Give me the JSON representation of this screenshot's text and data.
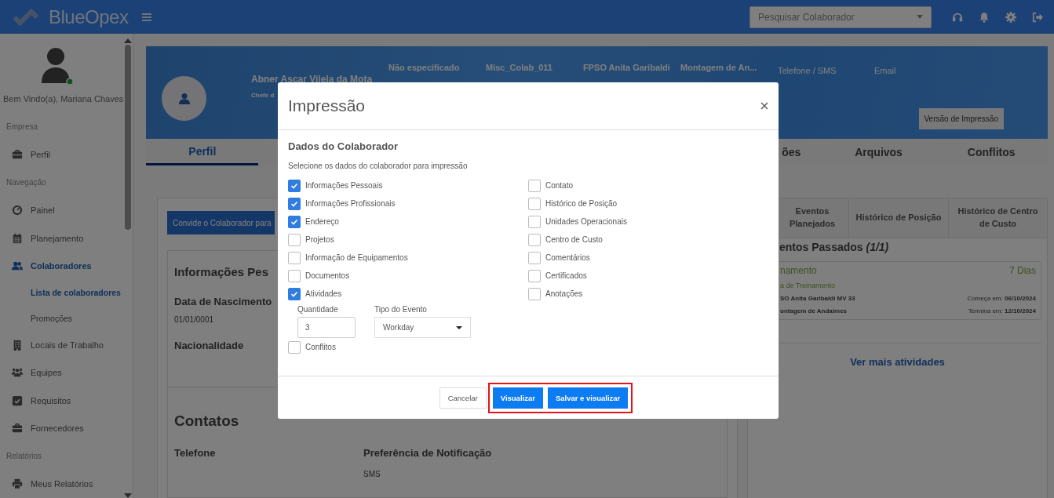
{
  "topbar": {
    "logo": "BlueOpex",
    "search": {
      "placeholder": "Pesquisar Colaborador"
    }
  },
  "sidebar": {
    "greeting": "Bem Vindo(a), Mariana Chaves",
    "sections": [
      {
        "title": "Empresa",
        "items": [
          {
            "label": "Perfil",
            "selected": false
          }
        ]
      },
      {
        "title": "Navegação",
        "items": [
          {
            "label": "Painel",
            "selected": false
          },
          {
            "label": "Planejamento",
            "selected": false
          },
          {
            "label": "Colaboradores",
            "selected": true,
            "children": [
              {
                "label": "Lista de colaboradores",
                "selected": true
              },
              {
                "label": "Promoções",
                "selected": false
              }
            ]
          },
          {
            "label": "Locais de Trabalho",
            "selected": false
          },
          {
            "label": "Equipes",
            "selected": false
          },
          {
            "label": "Requisitos",
            "selected": false
          },
          {
            "label": "Fornecedores",
            "selected": false
          }
        ]
      },
      {
        "title": "Relatórios",
        "items": [
          {
            "label": "Meus Relatórios",
            "selected": false
          }
        ]
      }
    ]
  },
  "profile": {
    "name": "Abner Ascar Vilela da Mota",
    "role": "Chefe d",
    "fields": [
      "Não especificado",
      "Misc_Colab_011",
      "FPSO Anita Garibaldi",
      "Montagem de An..."
    ],
    "contacts": [
      "Telefone / SMS",
      "Email"
    ],
    "print_button": "Versão de Impressão",
    "tabs": [
      {
        "label": "Perfil",
        "selected": true
      },
      {
        "label": "ões",
        "selected": false
      },
      {
        "label": "Arquivos",
        "selected": false
      },
      {
        "label": "Conflitos",
        "selected": false
      }
    ]
  },
  "left_panel": {
    "invite_button": "Convide o Colaborador para",
    "section_title": "Informações Pes",
    "fields": [
      {
        "label": "Data de Nascimento",
        "value": "01/01/0001"
      },
      {
        "label": "Nacionalidade"
      }
    ],
    "contacts_title": "Contatos",
    "contact_fields": [
      {
        "label": "Telefone"
      },
      {
        "label": "Preferência de Notificação",
        "value": "SMS"
      }
    ]
  },
  "right_panel": {
    "tabs": [
      {
        "label": "Eventos Planejados",
        "selected": false
      },
      {
        "label": "Histórico de Posição",
        "selected": false
      },
      {
        "label": "Histórico de Centro de Custo",
        "selected": false
      }
    ],
    "heading": "entos Passados *(1/1)*",
    "event": {
      "title": "namento",
      "duration": "7 Dias",
      "type": "a de Treinamento",
      "location": "SO Anita Garibaldi MV 33",
      "start": "Começa em: **06/10/2024**",
      "project": "ontagem de Andaimes",
      "end": "Termina em: **12/10/2024**"
    },
    "more_link": "Ver mais atividades"
  },
  "modal": {
    "title": "Impressão",
    "section_title": "Dados do Colaborador",
    "hint": "Selecione os dados do colaborador para impressão",
    "left_options": [
      {
        "label": "Informações Pessoais",
        "checked": true
      },
      {
        "label": "Informações Profissionais",
        "checked": true
      },
      {
        "label": "Endereço",
        "checked": true
      },
      {
        "label": "Projetos",
        "checked": false
      },
      {
        "label": "Informação de Equipamentos",
        "checked": false
      },
      {
        "label": "Documentos",
        "checked": false
      },
      {
        "label": "Atividades",
        "checked": true
      }
    ],
    "quantity": {
      "label": "Quantidade",
      "value": "3"
    },
    "event_type": {
      "label": "Tipo do Evento",
      "value": "Workday"
    },
    "after_options": [
      {
        "label": "Conflitos",
        "checked": false
      }
    ],
    "right_options": [
      {
        "label": "Contato",
        "checked": false
      },
      {
        "label": "Histórico de Posição",
        "checked": false
      },
      {
        "label": "Unidades Operacionais",
        "checked": false
      },
      {
        "label": "Centro de Custo",
        "checked": false
      },
      {
        "label": "Comentários",
        "checked": false
      },
      {
        "label": "Certificados",
        "checked": false
      },
      {
        "label": "Anotações",
        "checked": false
      }
    ],
    "buttons": [
      {
        "label": "Cancelar",
        "kind": "secondary",
        "highlighted": false
      },
      {
        "label": "Visualizar",
        "kind": "primary",
        "highlighted": true
      },
      {
        "label": "Salvar e visualizar",
        "kind": "primary",
        "highlighted": true
      }
    ]
  }
}
